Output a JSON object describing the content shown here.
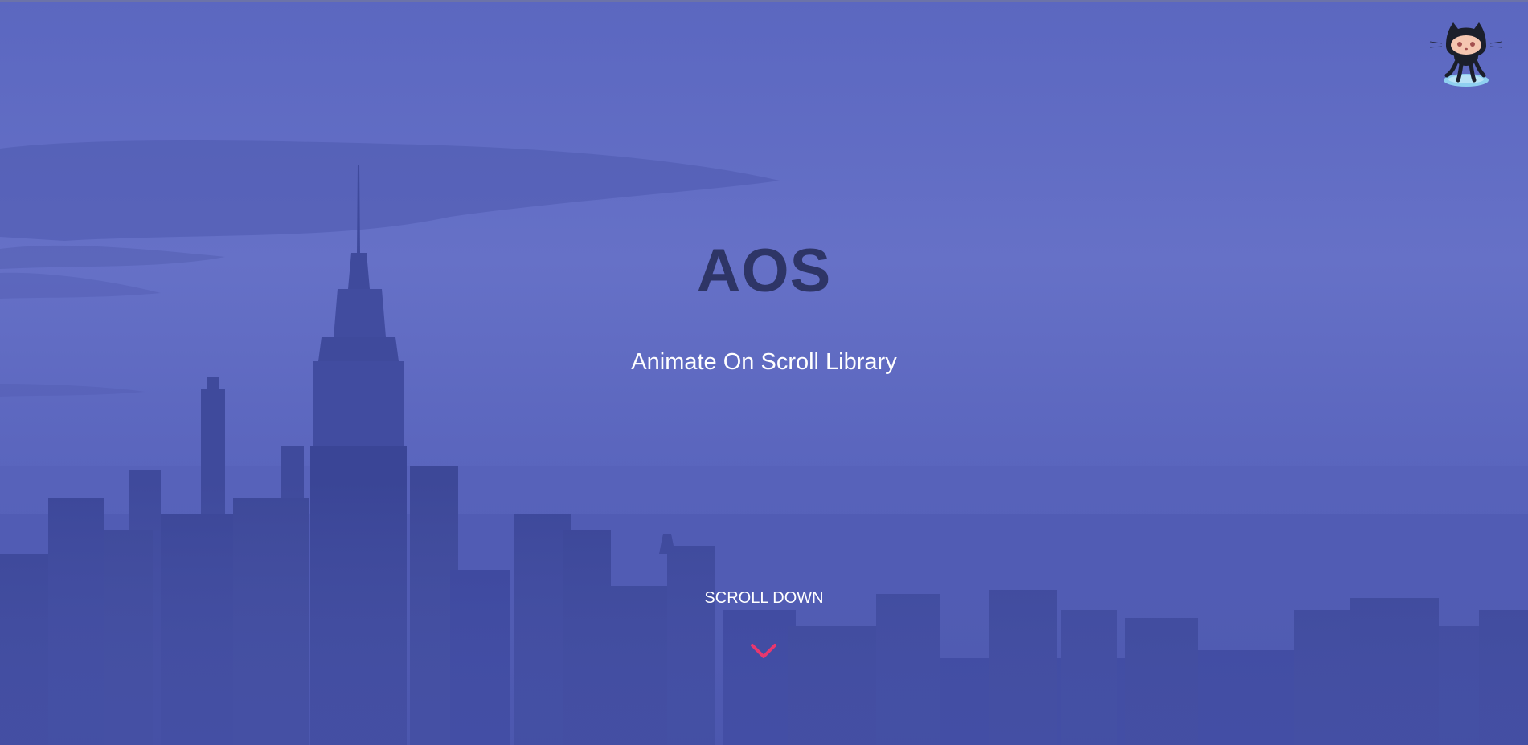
{
  "hero": {
    "title": "AOS",
    "subtitle": "Animate On Scroll Library",
    "scroll_label": "SCROLL DOWN",
    "chevron_icon": "chevron-down-icon",
    "github_icon": "octocat-icon"
  },
  "colors": {
    "overlay": "#5f6cc2",
    "title": "#2e3566",
    "subtitle": "#ffffff",
    "accent": "#e8376e"
  }
}
